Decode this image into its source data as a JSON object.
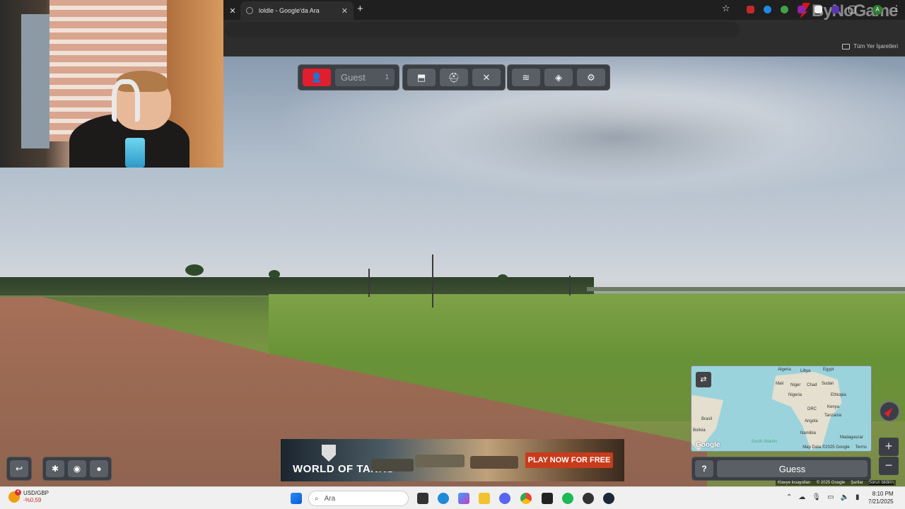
{
  "browser": {
    "active_tab_title": "loldle - Google'da Ara",
    "new_tab_symbol": "+",
    "close_symbol": "✕",
    "bookmarks_label": "Tüm Yer İşaretleri",
    "profile_initial": "A",
    "watermark": "ByNoGame"
  },
  "game": {
    "player_name": "Guest",
    "player_count": "1",
    "guess_label": "Guess",
    "help_label": "?"
  },
  "minimap": {
    "labels": [
      "Algeria",
      "Libya",
      "Egypt",
      "Mali",
      "Niger",
      "Chad",
      "Sudan",
      "Nigeria",
      "Ethiopia",
      "DRC",
      "Kenya",
      "Tanzania",
      "Angola",
      "Namibia",
      "Madagascar",
      "Brasil",
      "Bolivia",
      "South Atlantic"
    ],
    "google_logo": "Google",
    "attribution": "Map Data ©2025 Google",
    "terms": "Terms",
    "zoom_in": "+",
    "zoom_out": "−"
  },
  "footer_attribution": {
    "shortcuts": "Klavye kısayolları",
    "data": "© 2025 Google",
    "terms": "Şartlar",
    "report": "Sorun bildirin"
  },
  "ad": {
    "brand": "WORLD OF TANKS",
    "cta": "PLAY NOW FOR FREE"
  },
  "taskbar": {
    "ticker_name": "USD/GBP",
    "ticker_change": "-%0,59",
    "ticker_badge": "4",
    "search_placeholder": "Ara",
    "time": "8:10 PM",
    "date": "7/21/2025"
  }
}
